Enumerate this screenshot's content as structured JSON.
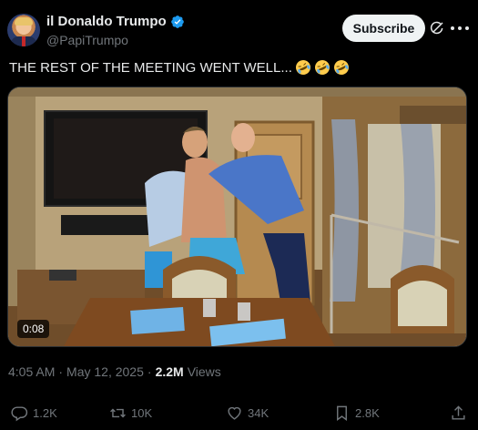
{
  "author": {
    "display_name": "il Donaldo Trumpo",
    "handle": "@PapiTrumpo",
    "verified_color": "#1d9bf0"
  },
  "header": {
    "subscribe_label": "Subscribe",
    "grok_icon": "grok-icon",
    "more_icon": "more-icon"
  },
  "tweet": {
    "text": "THE REST OF THE MEETING WENT WELL...",
    "emoji_count": 3,
    "emoji": "rolling-on-floor-laughing"
  },
  "video": {
    "duration": "0:08"
  },
  "meta": {
    "time": "4:05 AM",
    "separator1": "·",
    "date": "May 12, 2025",
    "separator2": "·",
    "views": "2.2M",
    "views_label": "Views"
  },
  "actions": {
    "replies": "1.2K",
    "reposts": "10K",
    "likes": "34K",
    "bookmarks": "2.8K"
  },
  "colors": {
    "background": "#000000",
    "text": "#e7e9ea",
    "muted": "#71767b",
    "accent": "#1d9bf0"
  }
}
